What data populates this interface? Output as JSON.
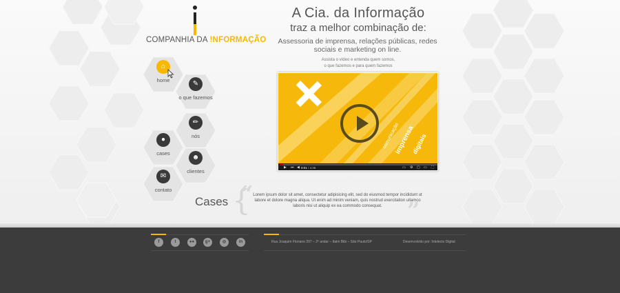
{
  "logo": {
    "prefix": "COMPANHIA DA ",
    "highlight": "!NFORMAÇÃO"
  },
  "nav": {
    "home": "home",
    "o_que_fazemos": "o que fazemos",
    "nos": "nós",
    "cases": "cases",
    "clientes": "clientes",
    "contato": "contato"
  },
  "headline": {
    "title": "A Cia. da Informação",
    "subtitle": "traz a melhor combinação de:",
    "description": "Assessoria de imprensa, relações públicas, redes sociais e marketing on line.",
    "small_line1": "Assista o vídeo e entenda quem somos,",
    "small_line2": "o que fazemos e para quem fazemos"
  },
  "video": {
    "current_time": "0:01",
    "duration": "4:36",
    "progress": 0.02,
    "overlay_words": [
      "comunicação",
      "imprensa",
      "digitais"
    ]
  },
  "cases": {
    "title": "Cases",
    "text": "Lorem ipsum dolor sit amet, consectetur adipisicing elit, sed do eiusmod tempor incididunt ut labore et dolore magna aliqua. Ut enim ad minim veniam, quis nostrud exercitation ullamco laboris nisi ut aliquip ex ea commodo consequat."
  },
  "footer": {
    "social": [
      "facebook-icon",
      "twitter-icon",
      "flickr-icon",
      "google-plus-icon",
      "instagram-icon",
      "linkedin-icon"
    ],
    "address": "Rua Joaquim Floriano 397 – 2º andar – Itaim Bibi – São Paulo/SP",
    "developer": "Desenvolvido por: Intelecto Digital"
  },
  "colors": {
    "accent": "#f7b800",
    "footer_bg": "#3c3c3c",
    "hex_fill": "#ececec"
  }
}
